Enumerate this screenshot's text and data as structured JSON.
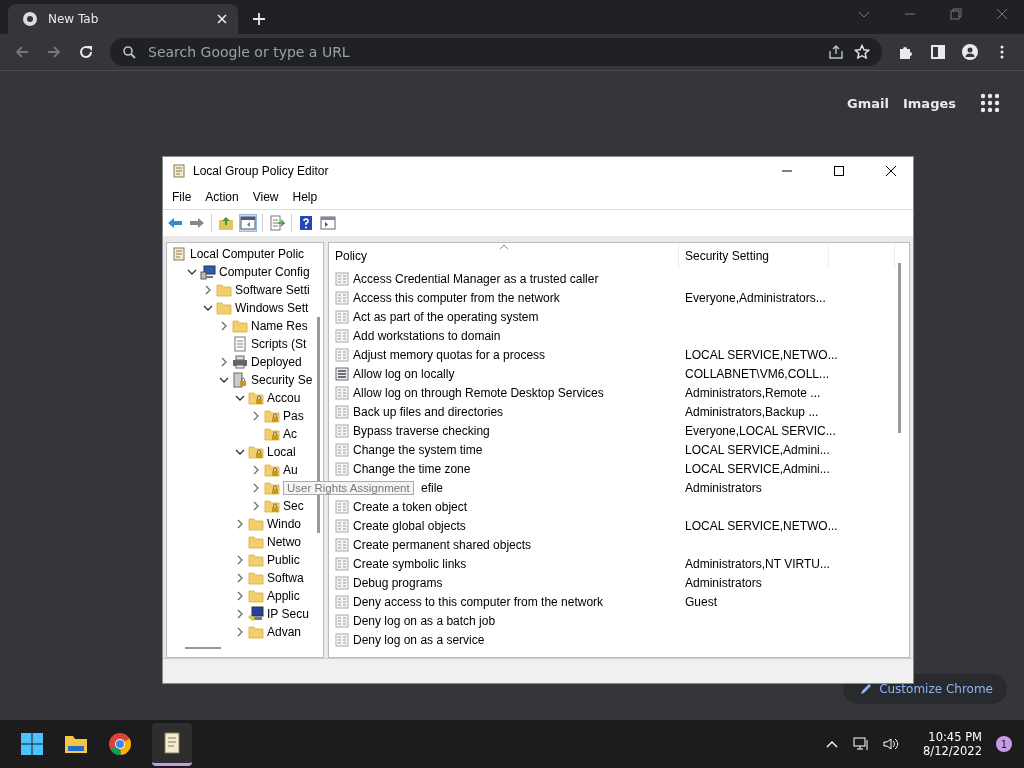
{
  "browser": {
    "tab": {
      "title": "New Tab",
      "selected": true
    },
    "address": {
      "placeholder": "Search Google or type a URL"
    },
    "links": [
      "Gmail",
      "Images"
    ],
    "customize": "Customize Chrome"
  },
  "window": {
    "title": "Local Group Policy Editor",
    "menu": [
      "File",
      "Action",
      "View",
      "Help"
    ],
    "tree": [
      {
        "label": "Local Computer Polic",
        "kind": "scroll",
        "children": [
          {
            "label": "Computer Config",
            "kind": "computer",
            "expanded": true,
            "children": [
              {
                "label": "Software Setti",
                "kind": "folder",
                "expanded": false
              },
              {
                "label": "Windows Sett",
                "kind": "folder",
                "expanded": true,
                "children": [
                  {
                    "label": "Name Res",
                    "kind": "folder",
                    "expanded": false
                  },
                  {
                    "label": "Scripts (St",
                    "kind": "script"
                  },
                  {
                    "label": "Deployed",
                    "kind": "printer",
                    "expanded": false
                  },
                  {
                    "label": "Security Se",
                    "kind": "secure",
                    "expanded": true,
                    "children": [
                      {
                        "label": "Accou",
                        "kind": "lockfolder",
                        "expanded": true,
                        "children": [
                          {
                            "label": "Pas",
                            "kind": "lockfolder",
                            "expanded": false
                          },
                          {
                            "label": "Ac",
                            "kind": "lockfolder"
                          }
                        ]
                      },
                      {
                        "label": "Local",
                        "kind": "lockfolder",
                        "expanded": true,
                        "children": [
                          {
                            "label": "Au",
                            "kind": "lockfolder",
                            "expanded": false
                          },
                          {
                            "kind": "lockfolder",
                            "expanded": false,
                            "tooltip": "User Rights Assignment"
                          },
                          {
                            "label": "Sec",
                            "kind": "lockfolder",
                            "expanded": false
                          }
                        ]
                      },
                      {
                        "label": "Windo",
                        "kind": "folder",
                        "expanded": false
                      },
                      {
                        "label": "Netwo",
                        "kind": "folder"
                      },
                      {
                        "label": "Public",
                        "kind": "folder",
                        "expanded": false
                      },
                      {
                        "label": "Softwa",
                        "kind": "folder",
                        "expanded": false
                      },
                      {
                        "label": "Applic",
                        "kind": "folder",
                        "expanded": false
                      },
                      {
                        "label": "IP Secu",
                        "kind": "ipsec",
                        "expanded": false
                      },
                      {
                        "label": "Advan",
                        "kind": "folder",
                        "expanded": false
                      }
                    ]
                  }
                ]
              }
            ]
          }
        ]
      }
    ],
    "columns": [
      "Policy",
      "Security Setting"
    ],
    "rows": [
      {
        "policy": "Access Credential Manager as a trusted caller",
        "kind": "policy"
      },
      {
        "policy": "Access this computer from the network",
        "setting": "Everyone,Administrators...",
        "kind": "policy"
      },
      {
        "policy": "Act as part of the operating system",
        "kind": "policy"
      },
      {
        "policy": "Add workstations to domain",
        "kind": "policy"
      },
      {
        "policy": "Adjust memory quotas for a process",
        "setting": "LOCAL SERVICE,NETWO...",
        "kind": "policy"
      },
      {
        "policy": "Allow log on locally",
        "setting": "COLLABNET\\VM6,COLL...",
        "kind": "list"
      },
      {
        "policy": "Allow log on through Remote Desktop Services",
        "setting": "Administrators,Remote ...",
        "kind": "policy"
      },
      {
        "policy": "Back up files and directories",
        "setting": "Administrators,Backup ...",
        "kind": "policy"
      },
      {
        "policy": "Bypass traverse checking",
        "setting": "Everyone,LOCAL SERVIC...",
        "kind": "policy"
      },
      {
        "policy": "Change the system time",
        "setting": "LOCAL SERVICE,Admini...",
        "kind": "policy"
      },
      {
        "policy": "Change the time zone",
        "setting": "LOCAL SERVICE,Admini...",
        "kind": "policy"
      },
      {
        "policy": "efile",
        "setting": "Administrators",
        "kind": "covered"
      },
      {
        "policy": "Create a token object",
        "kind": "policy"
      },
      {
        "policy": "Create global objects",
        "setting": "LOCAL SERVICE,NETWO...",
        "kind": "policy"
      },
      {
        "policy": "Create permanent shared objects",
        "kind": "policy"
      },
      {
        "policy": "Create symbolic links",
        "setting": "Administrators,NT VIRTU...",
        "kind": "policy"
      },
      {
        "policy": "Debug programs",
        "setting": "Administrators",
        "kind": "policy"
      },
      {
        "policy": "Deny access to this computer from the network",
        "setting": "Guest",
        "kind": "policy"
      },
      {
        "policy": "Deny log on as a batch job",
        "kind": "policy"
      },
      {
        "policy": "Deny log on as a service",
        "kind": "policy"
      }
    ]
  },
  "taskbar": {
    "time": "10:45 PM",
    "date": "8/12/2022",
    "notifications": "1"
  }
}
